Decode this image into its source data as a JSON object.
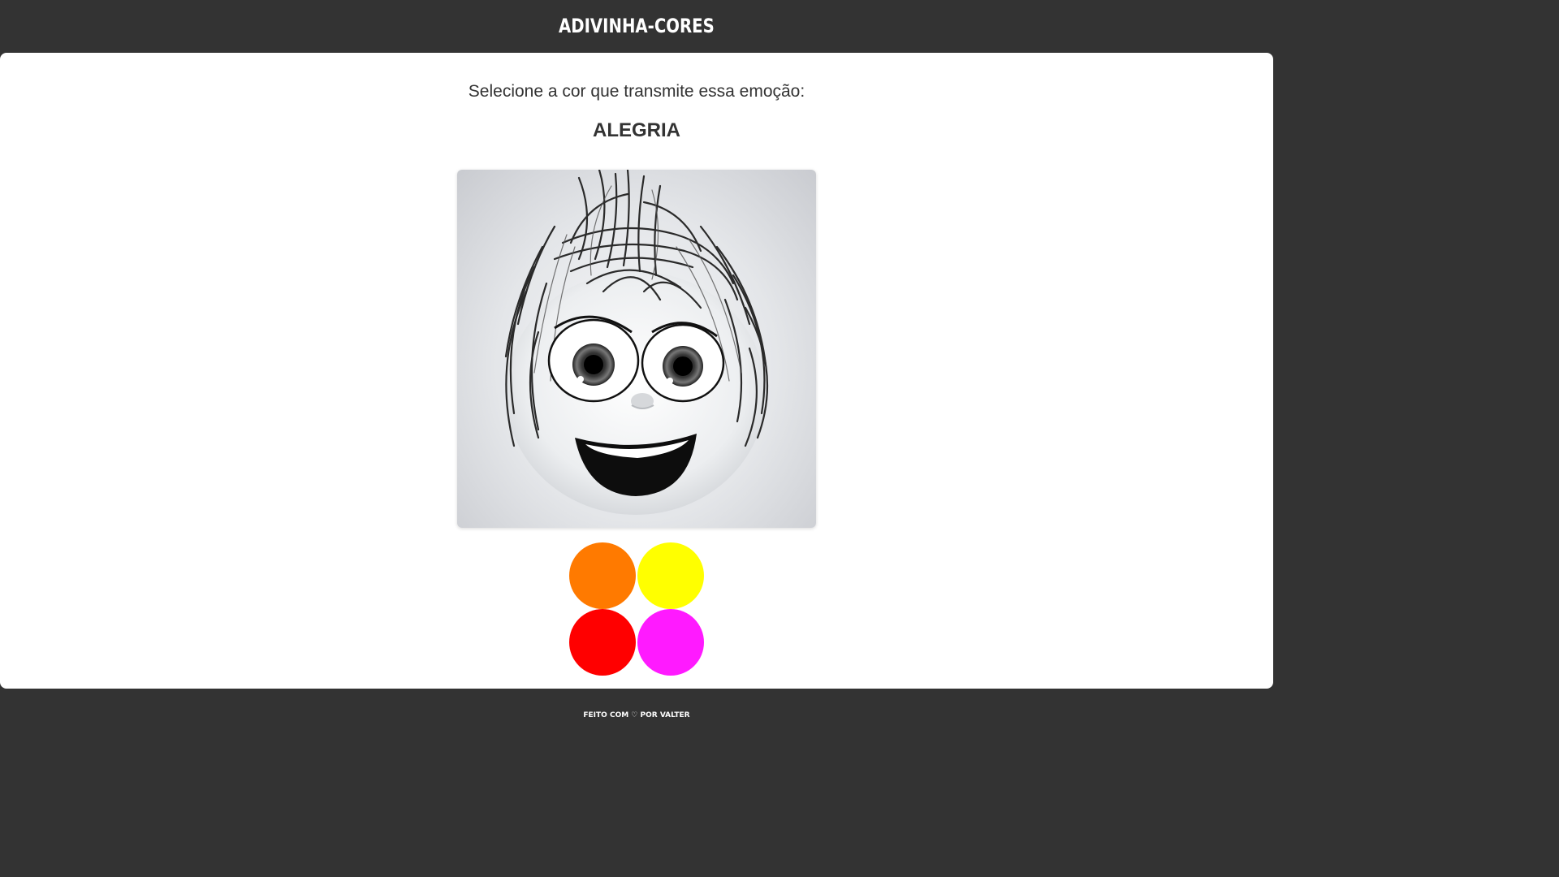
{
  "header": {
    "title": "ADIVINHA-CORES"
  },
  "game": {
    "prompt": "Selecione a cor que transmite essa emoção:",
    "emotion": "ALEGRIA",
    "image_alt": "joy-character-face-grayscale"
  },
  "color_options": [
    {
      "name": "orange",
      "hex": "#ff7a00"
    },
    {
      "name": "yellow",
      "hex": "#ffff00"
    },
    {
      "name": "red",
      "hex": "#ff0000"
    },
    {
      "name": "magenta",
      "hex": "#ff1aff"
    }
  ],
  "footer": {
    "text": "FEITO COM ♡ POR VALTER"
  },
  "theme": {
    "bar_color": "#333333",
    "background": "#ffffff",
    "text_color": "#333333"
  }
}
